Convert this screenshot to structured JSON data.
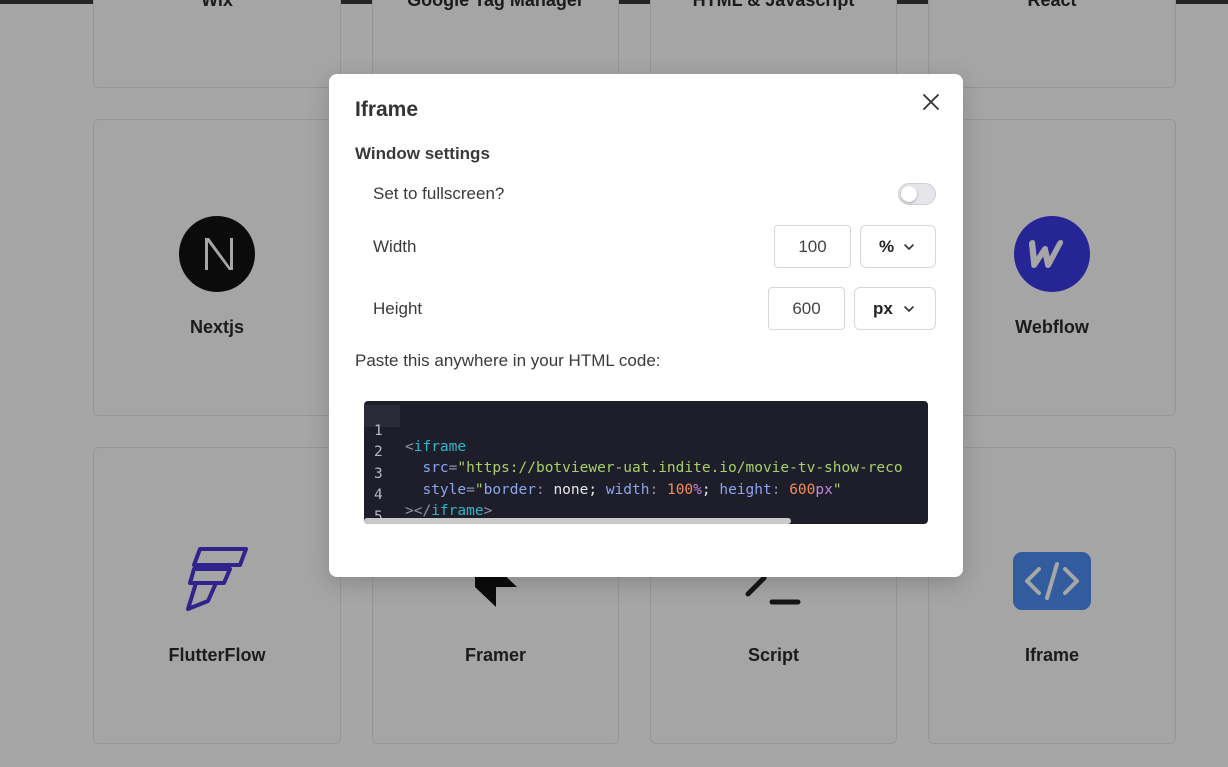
{
  "background": {
    "top_row_titles": [
      "Wix",
      "Google Tag Manager",
      "HTML & Javascript",
      "React"
    ],
    "cards": [
      {
        "title": "Nextjs",
        "icon": "nextjs-logo-icon"
      },
      {
        "title": "Webflow",
        "icon": "webflow-logo-icon"
      },
      {
        "title": "FlutterFlow",
        "icon": "flutterflow-logo-icon"
      },
      {
        "title": "Framer",
        "icon": "framer-logo-icon"
      },
      {
        "title": "Script",
        "icon": "terminal-prompt-icon"
      },
      {
        "title": "Iframe",
        "icon": "code-brackets-icon"
      }
    ],
    "colors": {
      "webflow": "#3b3ae6",
      "iframe": "#4d8ef2",
      "flutterflow": "#4b37d6"
    }
  },
  "modal": {
    "title": "Iframe",
    "close_icon": "close-icon",
    "section_title": "Window settings",
    "fullscreen_label": "Set to fullscreen?",
    "fullscreen_on": false,
    "width_label": "Width",
    "width_value": "100",
    "width_unit": "%",
    "height_label": "Height",
    "height_value": "600",
    "height_unit": "px",
    "paste_label": "Paste this anywhere in your HTML code:",
    "code": {
      "line_numbers": [
        "1",
        "2",
        "3",
        "4",
        "5"
      ],
      "tag_open": "<",
      "tag_name": "iframe",
      "src_attr": "src",
      "equals": "=",
      "src_value": "\"https://botviewer-uat.indite.io/movie-tv-show-reco",
      "style_attr": "style",
      "style_q1": "\"",
      "style_prop1": "border",
      "colon": ":",
      "style_val1": " none;",
      "style_prop2": " width",
      "style_num1": " 100",
      "style_unit1": "%",
      "semicolon": ";",
      "style_prop3": " height",
      "style_num2": " 600",
      "style_unit2": "px",
      "style_q2": "\"",
      "close_tag_open": "></",
      "close_tag_end": ">"
    }
  }
}
